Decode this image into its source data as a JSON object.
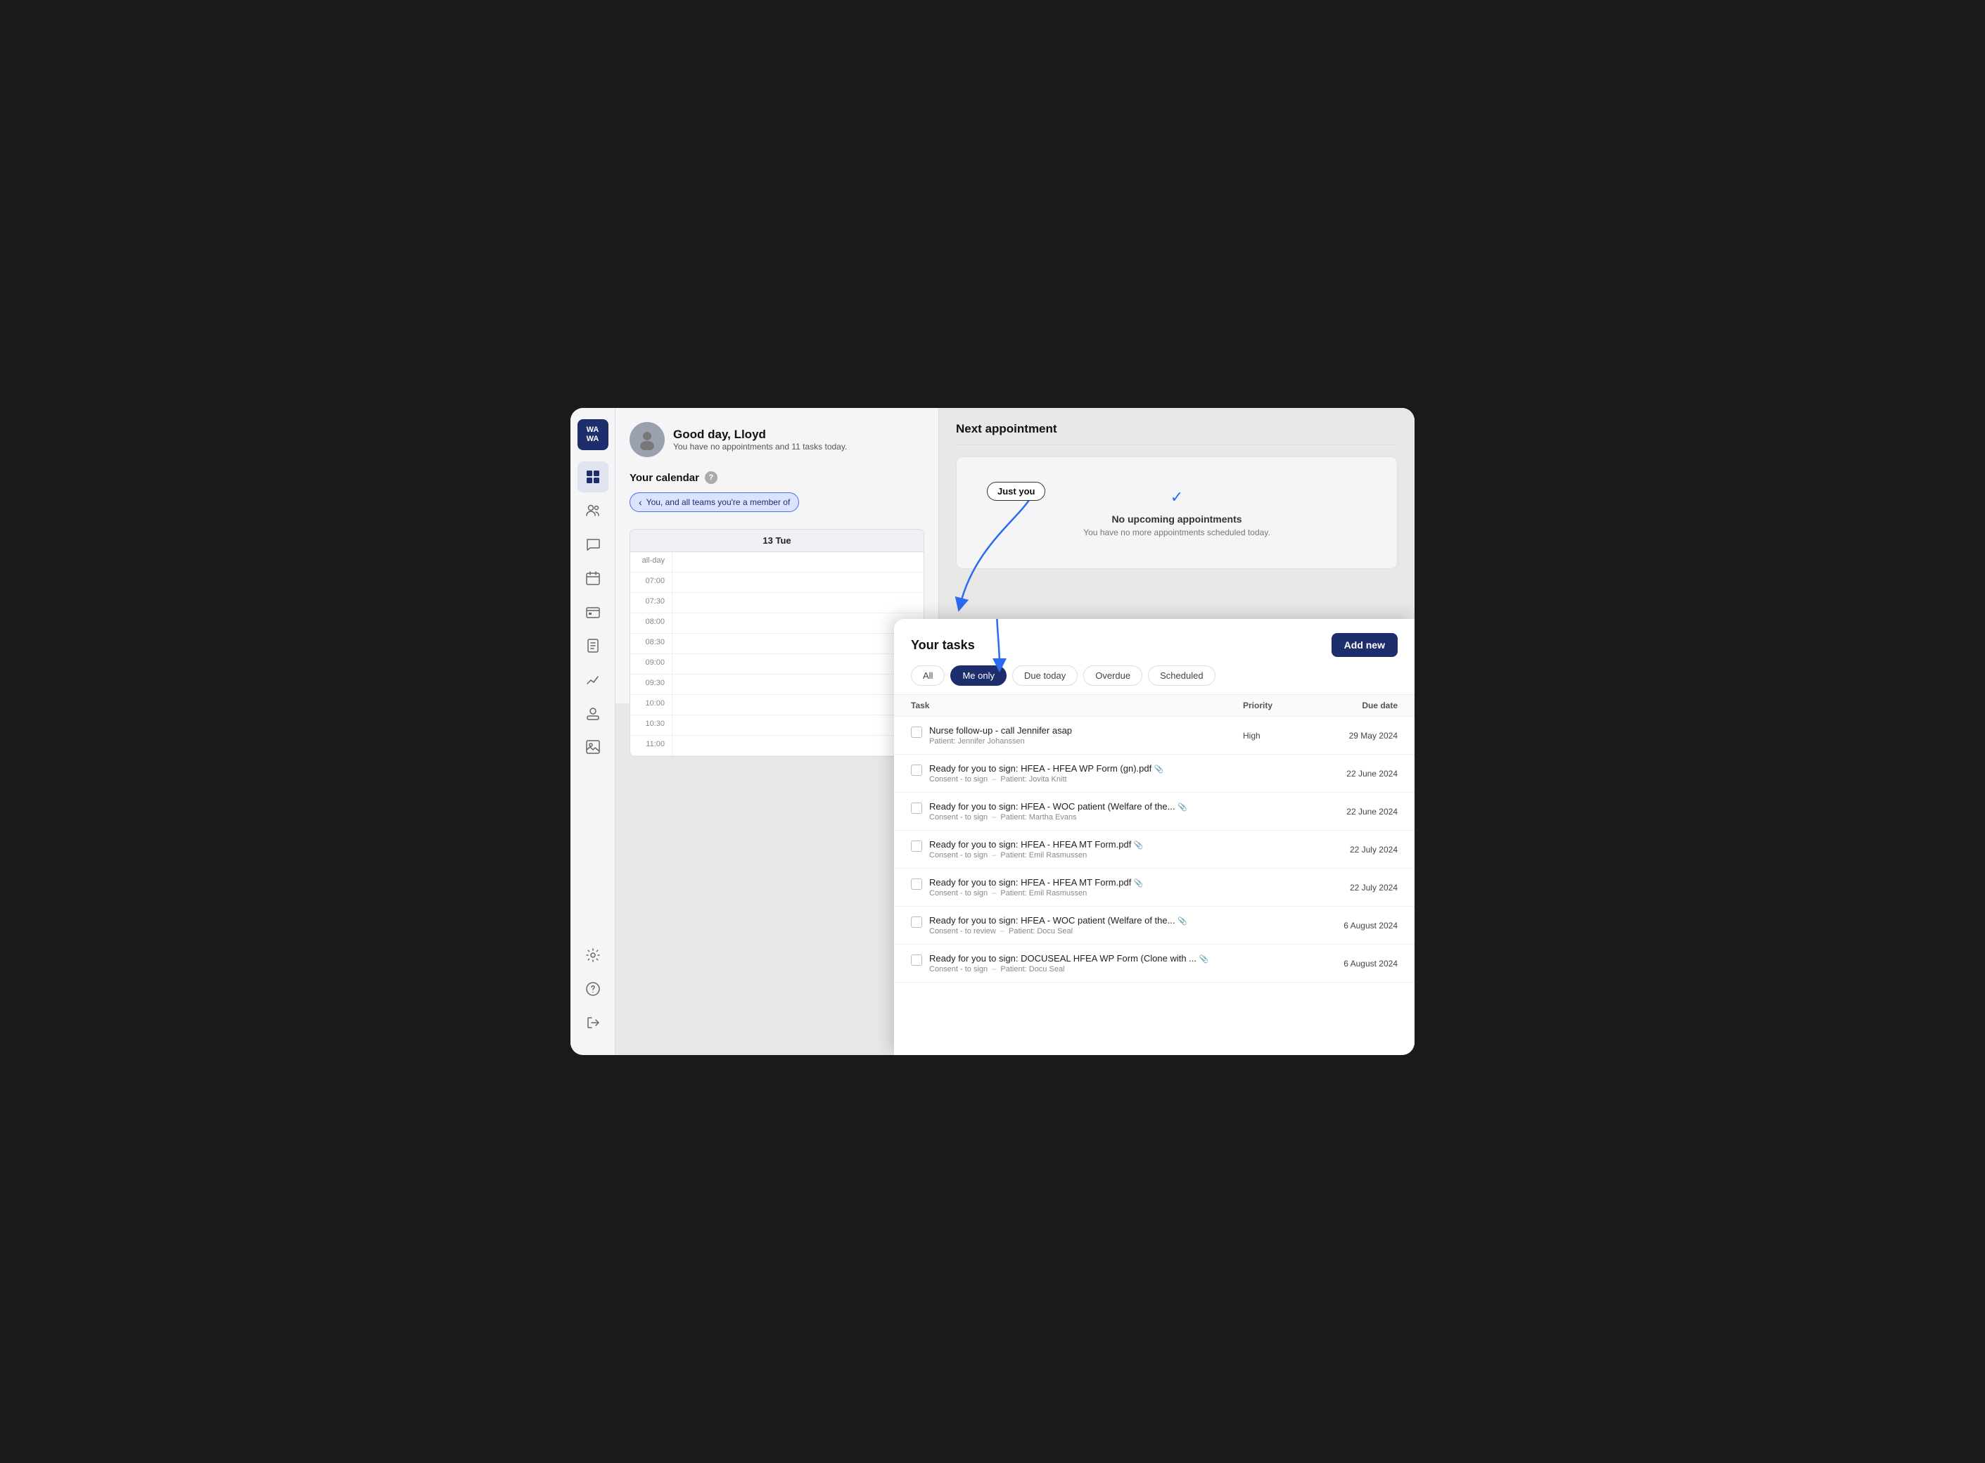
{
  "app": {
    "logo_line1": "WA",
    "logo_line2": "WA"
  },
  "header": {
    "greeting": "Good day, Lloyd",
    "subtitle": "You have no appointments and 11 tasks today."
  },
  "calendar": {
    "title": "Your calendar",
    "filter_label": "You, and all teams you're a member of",
    "day_label": "13 Tue",
    "time_slots": [
      {
        "label": "all-day",
        "content": ""
      },
      {
        "label": "07:00",
        "content": ""
      },
      {
        "label": "07:30",
        "content": ""
      },
      {
        "label": "08:00",
        "content": ""
      },
      {
        "label": "08:30",
        "content": ""
      },
      {
        "label": "09:00",
        "content": ""
      },
      {
        "label": "09:30",
        "content": ""
      },
      {
        "label": "10:00",
        "content": ""
      },
      {
        "label": "10:30",
        "content": ""
      },
      {
        "label": "11:00",
        "content": ""
      }
    ]
  },
  "next_appointment": {
    "title": "Next appointment",
    "no_appt_text": "No upcoming appointments",
    "no_appt_sub": "You have no more appointments scheduled today.",
    "just_you_badge": "Just you"
  },
  "tasks": {
    "title": "Your tasks",
    "add_new_label": "Add new",
    "filters": [
      {
        "label": "All",
        "active": false
      },
      {
        "label": "Me only",
        "active": true
      },
      {
        "label": "Due today",
        "active": false
      },
      {
        "label": "Overdue",
        "active": false
      },
      {
        "label": "Scheduled",
        "active": false
      }
    ],
    "table_headers": {
      "task": "Task",
      "priority": "Priority",
      "due_date": "Due date"
    },
    "rows": [
      {
        "name": "Nurse follow-up - call Jennifer asap",
        "sub_type": "Patient:",
        "sub_value": "Jennifer Johanssen",
        "priority": "High",
        "due_date": "29 May 2024",
        "has_attachment": false,
        "sub_prefix": ""
      },
      {
        "name": "Ready for you to sign: HFEA - HFEA WP Form (gn).pdf",
        "sub_type": "Consent - to sign",
        "sub_dash": "–",
        "sub_value": "Patient: Jovita Knitt",
        "priority": "",
        "due_date": "22 June 2024",
        "has_attachment": true
      },
      {
        "name": "Ready for you to sign: HFEA - WOC patient (Welfare of the...",
        "sub_type": "Consent - to sign",
        "sub_dash": "–",
        "sub_value": "Patient: Martha Evans",
        "priority": "",
        "due_date": "22 June 2024",
        "has_attachment": true
      },
      {
        "name": "Ready for you to sign: HFEA - HFEA MT Form.pdf",
        "sub_type": "Consent - to sign",
        "sub_dash": "–",
        "sub_value": "Patient: Emil Rasmussen",
        "priority": "",
        "due_date": "22 July 2024",
        "has_attachment": true
      },
      {
        "name": "Ready for you to sign: HFEA - HFEA MT Form.pdf",
        "sub_type": "Consent - to sign",
        "sub_dash": "–",
        "sub_value": "Patient: Emil Rasmussen",
        "priority": "",
        "due_date": "22 July 2024",
        "has_attachment": true
      },
      {
        "name": "Ready for you to sign: HFEA - WOC patient (Welfare of the...",
        "sub_type": "Consent - to review",
        "sub_dash": "–",
        "sub_value": "Patient: Docu Seal",
        "priority": "",
        "due_date": "6 August 2024",
        "has_attachment": true
      },
      {
        "name": "Ready for you to sign: DOCUSEAL HFEA WP Form (Clone with ...",
        "sub_type": "Consent - to sign",
        "sub_dash": "–",
        "sub_value": "Patient: Docu Seal",
        "priority": "",
        "due_date": "6 August 2024",
        "has_attachment": true
      }
    ]
  },
  "sidebar": {
    "items": [
      {
        "icon": "⊞",
        "name": "dashboard",
        "active": true
      },
      {
        "icon": "👥",
        "name": "users",
        "active": false
      },
      {
        "icon": "💬",
        "name": "messages",
        "active": false
      },
      {
        "icon": "📅",
        "name": "calendar",
        "active": false
      },
      {
        "icon": "💳",
        "name": "billing",
        "active": false
      },
      {
        "icon": "📋",
        "name": "reports",
        "active": false
      },
      {
        "icon": "📈",
        "name": "analytics",
        "active": false
      },
      {
        "icon": "👤",
        "name": "profile",
        "active": false
      },
      {
        "icon": "🖼",
        "name": "gallery",
        "active": false
      }
    ],
    "bottom_items": [
      {
        "icon": "⚙",
        "name": "settings"
      },
      {
        "icon": "?",
        "name": "help"
      },
      {
        "icon": "↗",
        "name": "export"
      }
    ]
  }
}
